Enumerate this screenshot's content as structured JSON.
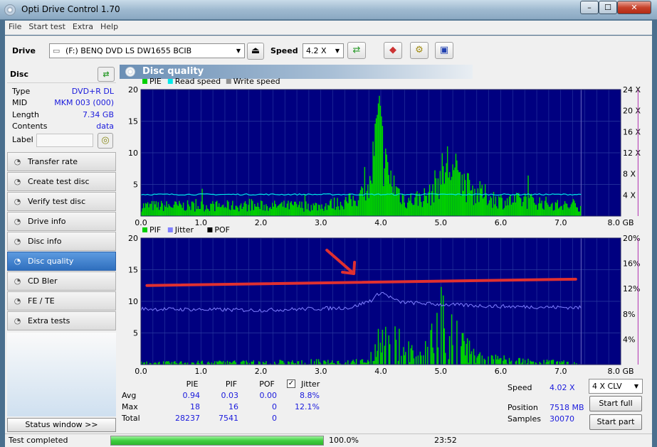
{
  "window": {
    "title": "Opti Drive Control 1.70"
  },
  "menu": [
    "File",
    "Start test",
    "Extra",
    "Help"
  ],
  "toolbar": {
    "drive_label": "Drive",
    "drive_value": "(F:)   BENQ DVD LS DW1655 BCIB",
    "speed_label": "Speed",
    "speed_value": "4.2 X"
  },
  "disc": {
    "header": "Disc",
    "fields": [
      {
        "key": "Type",
        "value": "DVD+R DL"
      },
      {
        "key": "MID",
        "value": "MKM 003 (000)"
      },
      {
        "key": "Length",
        "value": "7.34 GB"
      },
      {
        "key": "Contents",
        "value": "data"
      }
    ],
    "label_key": "Label"
  },
  "nav": [
    {
      "label": "Transfer rate",
      "icon": "transfer-rate-icon"
    },
    {
      "label": "Create test disc",
      "icon": "create-disc-icon"
    },
    {
      "label": "Verify test disc",
      "icon": "verify-disc-icon"
    },
    {
      "label": "Drive info",
      "icon": "drive-info-icon"
    },
    {
      "label": "Disc info",
      "icon": "disc-info-icon"
    },
    {
      "label": "Disc quality",
      "icon": "disc-quality-icon",
      "active": true
    },
    {
      "label": "CD Bler",
      "icon": "cd-bler-icon"
    },
    {
      "label": "FE / TE",
      "icon": "fe-te-icon"
    },
    {
      "label": "Extra tests",
      "icon": "extra-tests-icon"
    }
  ],
  "status_window_label": "Status window >>",
  "panel_title": "Disc quality",
  "chart_data": [
    {
      "type": "bar",
      "legend": [
        "PIE",
        "Read speed",
        "Write speed"
      ],
      "colors": {
        "PIE": "#00d000",
        "Read speed": "#00e8e8",
        "Write speed": "#909090",
        "background": "#000080",
        "grid": "#2a3aa0"
      },
      "x_ticks": [
        "0.0",
        "1.0",
        "2.0",
        "3.0",
        "4.0",
        "5.0",
        "6.0",
        "7.0",
        "8.0 GB"
      ],
      "xlim": [
        0,
        8
      ],
      "y_ticks_left": [
        "5",
        "10",
        "15",
        "20"
      ],
      "ylim_left": [
        0,
        20
      ],
      "y_ticks_right": [
        "4 X",
        "8 X",
        "12 X",
        "16 X",
        "20 X",
        "24 X"
      ],
      "ylim_right": [
        0,
        24
      ],
      "disc_end_gb": 7.34,
      "pie_profile": [
        {
          "x": 0.0,
          "y": 2
        },
        {
          "x": 0.5,
          "y": 2
        },
        {
          "x": 1.0,
          "y": 2
        },
        {
          "x": 1.5,
          "y": 2
        },
        {
          "x": 2.0,
          "y": 2
        },
        {
          "x": 2.5,
          "y": 2
        },
        {
          "x": 3.0,
          "y": 2
        },
        {
          "x": 3.5,
          "y": 3
        },
        {
          "x": 3.8,
          "y": 5
        },
        {
          "x": 3.95,
          "y": 18
        },
        {
          "x": 4.1,
          "y": 8
        },
        {
          "x": 4.4,
          "y": 3
        },
        {
          "x": 4.8,
          "y": 4
        },
        {
          "x": 5.1,
          "y": 10
        },
        {
          "x": 5.5,
          "y": 5
        },
        {
          "x": 6.0,
          "y": 3
        },
        {
          "x": 6.5,
          "y": 3
        },
        {
          "x": 7.0,
          "y": 2
        },
        {
          "x": 7.34,
          "y": 2
        }
      ],
      "read_speed_x": 4.1
    },
    {
      "type": "bar",
      "legend": [
        "PIF",
        "Jitter",
        "POF"
      ],
      "colors": {
        "PIF": "#00d000",
        "Jitter": "#8080ff",
        "POF": "#000000",
        "background": "#000080",
        "grid": "#2a3aa0",
        "annotation": "#e03030"
      },
      "x_ticks": [
        "0.0",
        "1.0",
        "2.0",
        "3.0",
        "4.0",
        "5.0",
        "6.0",
        "7.0",
        "8.0 GB"
      ],
      "xlim": [
        0,
        8
      ],
      "y_ticks_left": [
        "5",
        "10",
        "15",
        "20"
      ],
      "ylim_left": [
        0,
        20
      ],
      "y_ticks_right": [
        "4%",
        "8%",
        "12%",
        "16%",
        "20%"
      ],
      "ylim_right": [
        0,
        20
      ],
      "disc_end_gb": 7.34,
      "pif_profile": [
        {
          "x": 0.0,
          "y": 0.5
        },
        {
          "x": 3.8,
          "y": 1
        },
        {
          "x": 3.95,
          "y": 7
        },
        {
          "x": 4.3,
          "y": 6
        },
        {
          "x": 4.7,
          "y": 2
        },
        {
          "x": 4.95,
          "y": 16
        },
        {
          "x": 5.2,
          "y": 8
        },
        {
          "x": 5.6,
          "y": 2
        },
        {
          "x": 6.5,
          "y": 1
        },
        {
          "x": 7.34,
          "y": 0.5
        }
      ],
      "jitter_profile": [
        {
          "x": 0.0,
          "y": 8.8
        },
        {
          "x": 2.0,
          "y": 8.6
        },
        {
          "x": 3.5,
          "y": 9.0
        },
        {
          "x": 3.85,
          "y": 10.2
        },
        {
          "x": 4.0,
          "y": 11.5
        },
        {
          "x": 4.3,
          "y": 9.9
        },
        {
          "x": 5.0,
          "y": 9.5
        },
        {
          "x": 6.0,
          "y": 9.2
        },
        {
          "x": 7.34,
          "y": 9.0
        }
      ],
      "annotation_line": {
        "x1": 0.1,
        "y1": 12.5,
        "x2": 7.25,
        "y2": 13.5
      }
    }
  ],
  "stats": {
    "headers": [
      "PIE",
      "PIF",
      "POF",
      "Jitter"
    ],
    "rows": [
      {
        "label": "Avg",
        "values": [
          "0.94",
          "0.03",
          "0.00",
          "8.8%"
        ]
      },
      {
        "label": "Max",
        "values": [
          "18",
          "16",
          "0",
          "12.1%"
        ]
      },
      {
        "label": "Total",
        "values": [
          "28237",
          "7541",
          "0",
          ""
        ]
      }
    ],
    "jitter_checked": true,
    "speed_label": "Speed",
    "speed_value": "4.02 X",
    "position_label": "Position",
    "position_value": "7518 MB",
    "samples_label": "Samples",
    "samples_value": "30070",
    "mode_value": "4 X CLV",
    "start_full": "Start full",
    "start_part": "Start part"
  },
  "status": {
    "text": "Test completed",
    "progress": 1.0,
    "progress_text": "100.0%",
    "time": "23:52"
  }
}
